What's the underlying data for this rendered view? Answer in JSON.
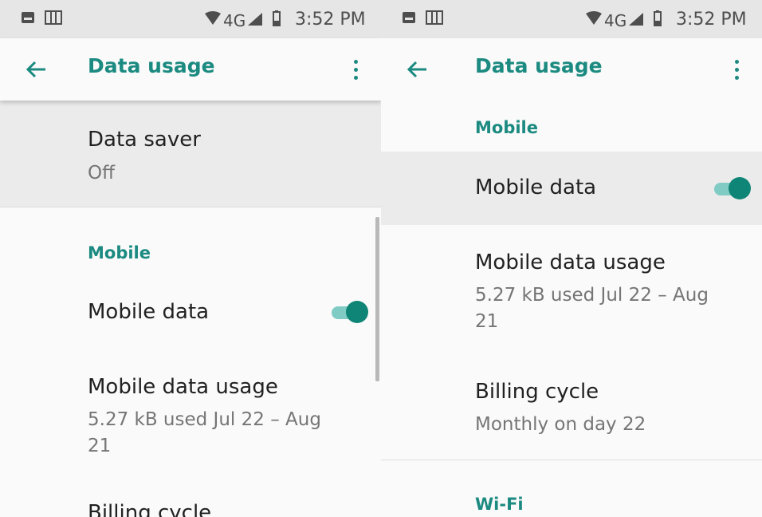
{
  "colors": {
    "accent": "#1b8a80",
    "highlight": "#ebebeb",
    "status_bar": "#e6e6e6"
  },
  "status_bar": {
    "time": "3:52 PM",
    "network": "4G",
    "icons": [
      "image-icon",
      "sim-card-icon",
      "wifi-icon",
      "signal-icon",
      "battery-icon"
    ]
  },
  "left": {
    "app_bar": {
      "title": "Data usage",
      "back_icon": "arrow-back-icon",
      "more_icon": "more-vert-icon"
    },
    "data_saver": {
      "title": "Data saver",
      "summary": "Off"
    },
    "mobile_category": "Mobile",
    "mobile_data": {
      "title": "Mobile data",
      "enabled": true
    },
    "mobile_data_usage": {
      "title": "Mobile data usage",
      "summary_line1": "5.27 kB used Jul 22 – Aug",
      "summary_line2": "21"
    },
    "billing_cycle": {
      "title": "Billing cycle"
    }
  },
  "right": {
    "app_bar": {
      "title": "Data usage",
      "back_icon": "arrow-back-icon",
      "more_icon": "more-vert-icon"
    },
    "mobile_category": "Mobile",
    "mobile_data": {
      "title": "Mobile data",
      "enabled": true
    },
    "mobile_data_usage": {
      "title": "Mobile data usage",
      "summary_line1": "5.27 kB used Jul 22 – Aug",
      "summary_line2": "21"
    },
    "billing_cycle": {
      "title": "Billing cycle",
      "summary": "Monthly on day 22"
    },
    "wifi_category": "Wi-Fi"
  }
}
